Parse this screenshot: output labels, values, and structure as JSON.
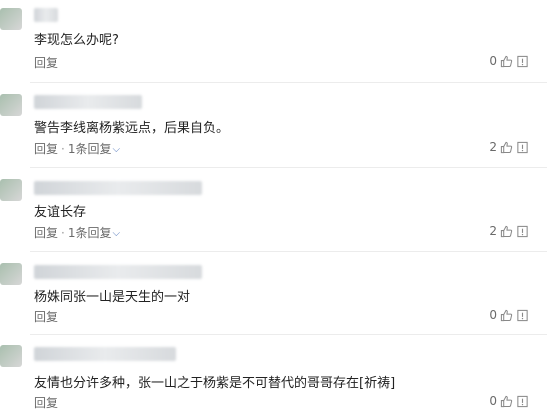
{
  "comments": [
    {
      "text": "李现怎么办呢?",
      "reply_label": "回复",
      "replies_label": "",
      "likes": "0"
    },
    {
      "text": "警告李线离杨紫远点，后果自负。",
      "reply_label": "回复",
      "replies_label": "1条回复",
      "likes": "2"
    },
    {
      "text": "友谊长存",
      "reply_label": "回复",
      "replies_label": "1条回复",
      "likes": "2"
    },
    {
      "text": "杨姝同张一山是天生的一对",
      "reply_label": "回复",
      "replies_label": "",
      "likes": "0"
    },
    {
      "text": "友情也分许多种，张一山之于杨紫是不可替代的哥哥存在[祈祷]",
      "reply_label": "回复",
      "replies_label": "",
      "likes": "0"
    }
  ],
  "icons": {
    "like": "thumbs-up-icon",
    "report": "flag-icon",
    "expand": "chevron-down-icon"
  },
  "colors": {
    "link_accent": "#5b7fbf",
    "text": "#222222",
    "muted": "#6a6a6a"
  }
}
